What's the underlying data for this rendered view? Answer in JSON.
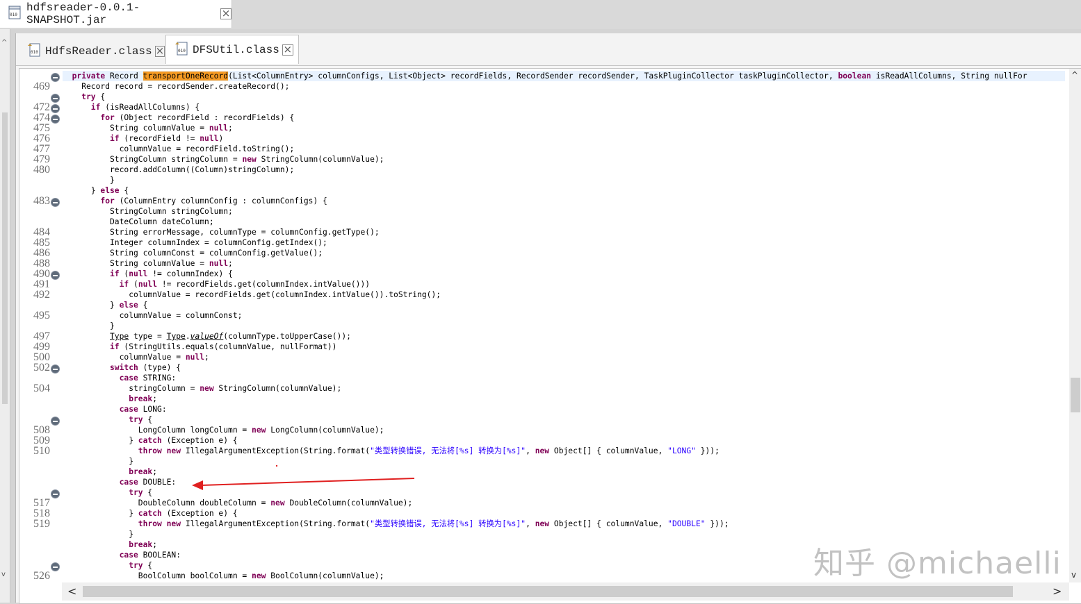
{
  "outer_tab": {
    "label": "hdfsreader-0.0.1-SNAPSHOT.jar"
  },
  "editor_tabs": [
    {
      "label": "HdfsReader.class"
    },
    {
      "label": "DFSUtil.class"
    }
  ],
  "line_numbers": [
    "469",
    "472",
    "474",
    "475",
    "476",
    "477",
    "479",
    "480",
    "483",
    "484",
    "485",
    "486",
    "488",
    "490",
    "491",
    "492",
    "495",
    "497",
    "499",
    "500",
    "502",
    "504",
    "508",
    "509",
    "510",
    "517",
    "518",
    "519",
    "526"
  ],
  "code_lines": [
    "private Record transportOneRecord(List<ColumnEntry> columnConfigs, List<Object> recordFields, RecordSender recordSender, TaskPluginCollector taskPluginCollector, boolean isReadAllColumns, String nullFor",
    "Record record = recordSender.createRecord();",
    "try {",
    "if (isReadAllColumns) {",
    "for (Object recordField : recordFields) {",
    "String columnValue = null;",
    "if (recordField != null)",
    "columnValue = recordField.toString();",
    "StringColumn stringColumn = new StringColumn(columnValue);",
    "record.addColumn((Column)stringColumn);",
    "}",
    "} else {",
    "for (ColumnEntry columnConfig : columnConfigs) {",
    "StringColumn stringColumn;",
    "DateColumn dateColumn;",
    "String errorMessage, columnType = columnConfig.getType();",
    "Integer columnIndex = columnConfig.getIndex();",
    "String columnConst = columnConfig.getValue();",
    "String columnValue = null;",
    "if (null != columnIndex) {",
    "if (null != recordFields.get(columnIndex.intValue()))",
    "columnValue = recordFields.get(columnIndex.intValue()).toString();",
    "} else {",
    "columnValue = columnConst;",
    "}",
    "Type type = Type.valueOf(columnType.toUpperCase());",
    "if (StringUtils.equals(columnValue, nullFormat))",
    "columnValue = null;",
    "switch (type) {",
    "case STRING:",
    "stringColumn = new StringColumn(columnValue);",
    "break;",
    "case LONG:",
    "try {",
    "LongColumn longColumn = new LongColumn(columnValue);",
    "} catch (Exception e) {",
    "throw new IllegalArgumentException(String.format(\"类型转换错误, 无法将[%s] 转换为[%s]\", new Object[] { columnValue, \"LONG\" }));",
    "}",
    "break;",
    "case DOUBLE:",
    "try {",
    "DoubleColumn doubleColumn = new DoubleColumn(columnValue);",
    "} catch (Exception e) {",
    "throw new IllegalArgumentException(String.format(\"类型转换错误, 无法将[%s] 转换为[%s]\", new Object[] { columnValue, \"DOUBLE\" }));",
    "}",
    "break;",
    "case BOOLEAN:",
    "try {",
    "BoolColumn boolColumn = new BoolColumn(columnValue);"
  ],
  "watermark": "知乎 @michaelli",
  "colors": {
    "keyword": "#7f0055",
    "string": "#2a00ff",
    "highlight": "#f59a23",
    "current_line": "#e8f2fe",
    "annotation_arrow": "#e02020"
  },
  "icons": [
    "class-file-icon",
    "jar-file-icon",
    "close-icon",
    "fold-collapse-icon",
    "scroll-up-icon",
    "scroll-down-icon",
    "scroll-left-icon",
    "scroll-right-icon"
  ]
}
